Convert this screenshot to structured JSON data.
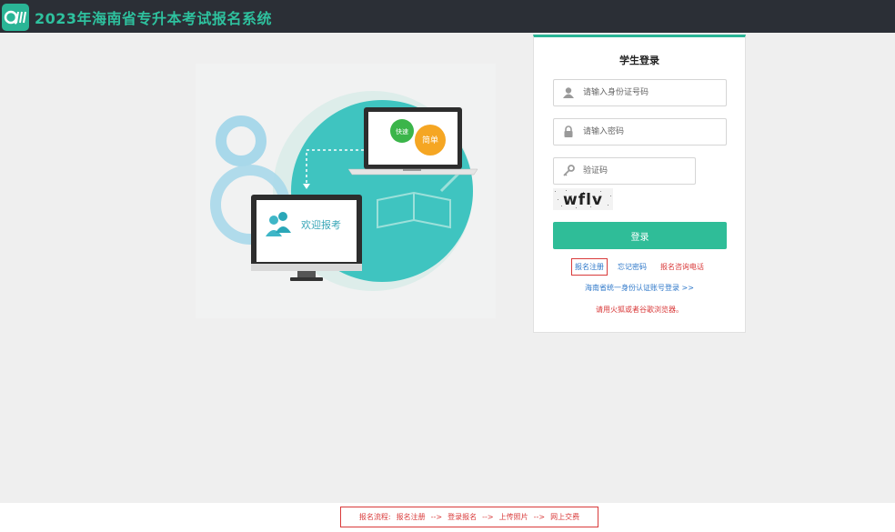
{
  "header": {
    "title": "2023年海南省专升本考试报名系统",
    "logo_text": "QIII"
  },
  "illustration": {
    "welcome_text": "欢迎报考",
    "badge_fast": "快速",
    "badge_simple": "简单"
  },
  "login": {
    "title": "学生登录",
    "id_placeholder": "请输入身份证号码",
    "password_placeholder": "请输入密码",
    "captcha_placeholder": "验证码",
    "captcha_text": "wflv",
    "submit_label": "登录",
    "register_link": "报名注册",
    "forgot_link": "忘记密码",
    "phone_link": "报名咨询电话",
    "unified_login_link": "海南省统一身份认证账号登录 >>",
    "browser_note": "请用火狐或者谷歌浏览器。"
  },
  "footer": {
    "flow_label": "报名流程:",
    "steps": [
      "报名注册",
      "登录报名",
      "上传照片",
      "网上交费"
    ],
    "arrow": "-->"
  },
  "colors": {
    "accent": "#2ab596",
    "header_bg": "#2b2f36",
    "link_blue": "#2d77c9",
    "warning_red": "#d93a3a"
  },
  "icons": [
    "user-icon",
    "lock-icon",
    "key-icon"
  ]
}
